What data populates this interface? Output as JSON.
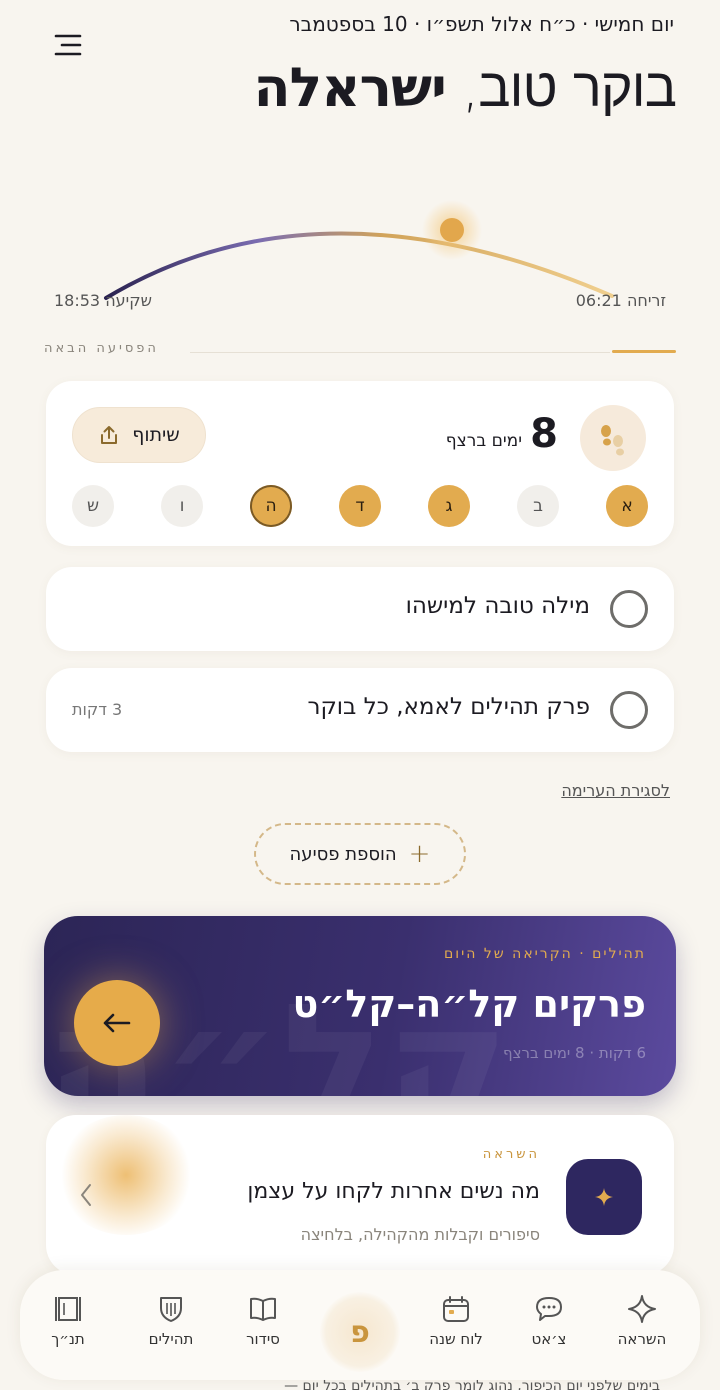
{
  "header": {
    "date_line": "יום חמישי · כ״ח אלול תשפ״ו · 10 בספטמבר",
    "greeting": "בוקר טוב,",
    "name": "ישראלה"
  },
  "sun": {
    "sunrise_label": "זריחה 06:21",
    "sunset_label": "שקיעה 18:53",
    "progress": 0.62
  },
  "next_section": {
    "title": "הפסיעה הבאה"
  },
  "streak": {
    "count": "8",
    "label": "ימים ברצף",
    "share_label": "שיתוף",
    "days": [
      {
        "letter": "א",
        "state": "done"
      },
      {
        "letter": "ב",
        "state": "todo"
      },
      {
        "letter": "ג",
        "state": "done"
      },
      {
        "letter": "ד",
        "state": "done"
      },
      {
        "letter": "ה",
        "state": "today"
      },
      {
        "letter": "ו",
        "state": "todo"
      },
      {
        "letter": "ש",
        "state": "todo"
      }
    ]
  },
  "tasks": [
    {
      "title": "מילה טובה למישהו",
      "time": ""
    },
    {
      "title": "פרק תהילים לאמא, כל בוקר",
      "time": "3 דקות"
    }
  ],
  "edit_link": "לסגירת הערימה",
  "add_step": "הוספת פסיעה",
  "reading": {
    "kicker": "תהילים · הקריאה של היום",
    "title": "פרקים קל״ה–קל״ט",
    "meta": "6 דקות · 8 ימים ברצף",
    "bg_glyph": "קל״ה"
  },
  "inspiration": {
    "kicker": "השראה",
    "title": "מה נשים אחרות לקחו על עצמן",
    "subtitle": "סיפורים וקבלות מהקהילה, בלחיצה"
  },
  "bottom_text": "בימים שלפני יום הכיפור, נהוג לומר פרק ב׳ בתהילים בכל יום —",
  "tabs": [
    {
      "label": "השראה",
      "icon": "sparkle-icon"
    },
    {
      "label": "צ׳אט",
      "icon": "chat-icon"
    },
    {
      "label": "לוח שנה",
      "icon": "calendar-icon"
    },
    {
      "label": "סידור",
      "icon": "book-icon"
    },
    {
      "label": "תהילים",
      "icon": "shield-icon"
    },
    {
      "label": "תנ״ך",
      "icon": "scroll-icon"
    }
  ],
  "center_tab_glyph": "פ",
  "colors": {
    "accent": "#e2ab4f",
    "indigo": "#2e2760",
    "background": "#f8f5ef"
  }
}
